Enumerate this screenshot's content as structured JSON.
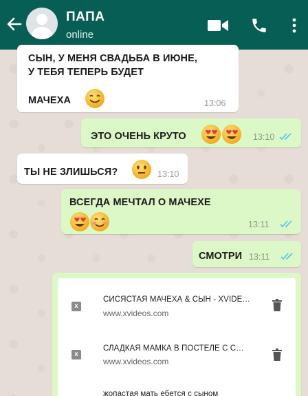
{
  "header": {
    "title": "ПАПА",
    "status": "online"
  },
  "messages": [
    {
      "line1": "СЫН, У МЕНЯ СВАДЬБА В ИЮНЕ,",
      "line2": "У ТЕБЯ ТЕПЕРЬ БУДЕТ",
      "line3": "МАЧЕХА",
      "time": "13:06"
    },
    {
      "text": "ЭТО ОЧЕНЬ КРУТО",
      "time": "13:10"
    },
    {
      "text": "ТЫ НЕ ЗЛИШЬСЯ?",
      "time": "13:10"
    },
    {
      "text": "ВСЕГДА МЕЧТАЛ О МАЧЕХЕ",
      "time": "13:11"
    },
    {
      "text": "СМОТРИ",
      "time": "13:11"
    }
  ],
  "links": [
    {
      "icon": "x",
      "title": "СИСЯСТАЯ МАЧЕХА & СЫН - XVIDE…",
      "url": "www.xvideos.com"
    },
    {
      "icon": "x",
      "title": "СЛАДКАЯ МАМКА В ПОСТЕЛЕ С С…",
      "url": "www.xvideos.com"
    },
    {
      "icon": "",
      "title": "жопастая мать ебется с сыном",
      "url": ""
    }
  ],
  "colors": {
    "header": "#075e54",
    "outgoing_bubble": "#dcf8c6",
    "incoming_bubble": "#ffffff",
    "read_ticks": "#4fc3f7"
  },
  "icons": [
    "back-arrow-icon",
    "video-call-icon",
    "phone-icon",
    "more-vert-icon",
    "smile-emoji-icon",
    "heart-eyes-emoji-icon",
    "neutral-emoji-icon",
    "blush-emoji-icon",
    "double-check-icon",
    "trash-icon"
  ]
}
